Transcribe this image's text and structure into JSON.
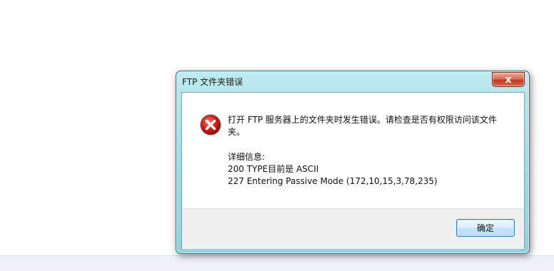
{
  "dialog": {
    "title": "FTP 文件夹错误",
    "close_label": "x",
    "message": "打开 FTP 服务器上的文件夹时发生错误。请检查是否有权限访问该文件夹。",
    "details_heading": "详细信息:",
    "details_lines": [
      "200 TYPE目前是 ASCII",
      "227 Entering Passive Mode (172,10,15,3,78,235)"
    ],
    "ok_label": "确定",
    "icon": "error-icon"
  },
  "colors": {
    "titlebar": "#9fdfe6",
    "close": "#c0391f",
    "error": "#d8201b"
  }
}
